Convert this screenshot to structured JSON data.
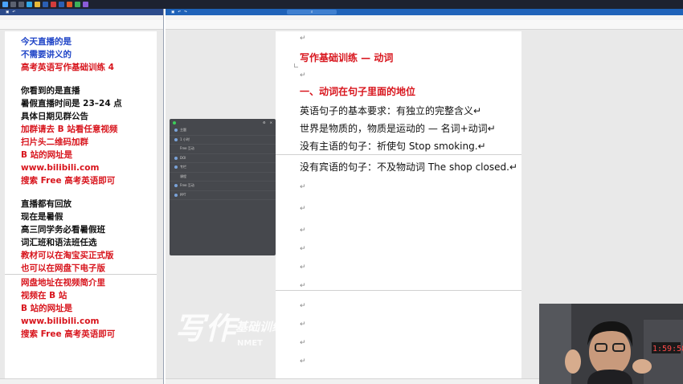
{
  "left_doc": {
    "lines": [
      {
        "text": "今天直播的是",
        "color": "blue"
      },
      {
        "text": "不需要讲义的",
        "color": "blue"
      },
      {
        "text": "高考英语写作基础训练 4",
        "color": "red"
      },
      {
        "text": "你看到的是直播",
        "color": "black"
      },
      {
        "text": "暑假直播时间是 23–24 点",
        "color": "black"
      },
      {
        "text": "具体日期见群公告",
        "color": "black"
      },
      {
        "text": "加群请去 B 站看任意视频",
        "color": "red"
      },
      {
        "text": "扫片头二维码加群",
        "color": "red"
      },
      {
        "text": "B 站的网址是",
        "color": "red"
      },
      {
        "text": "www.bilibili.com",
        "color": "red"
      },
      {
        "text": "搜索 Free 高考英语即可",
        "color": "red"
      },
      {
        "text": "直播都有回放",
        "color": "black"
      },
      {
        "text": "现在是暑假",
        "color": "black"
      },
      {
        "text": "高三同学务必看暑假班",
        "color": "black"
      },
      {
        "text": "词汇班和语法班任选",
        "color": "black"
      },
      {
        "text": "教材可以在淘宝买正式版",
        "color": "red"
      },
      {
        "text": "也可以在网盘下电子版",
        "color": "red"
      },
      {
        "text": "网盘地址在视频简介里",
        "color": "red"
      },
      {
        "text": "视频在 B 站",
        "color": "red"
      },
      {
        "text": "B 站的网址是",
        "color": "red"
      },
      {
        "text": "www.bilibili.com",
        "color": "red"
      },
      {
        "text": "搜索 Free 高考英语即可",
        "color": "red"
      }
    ]
  },
  "right_doc": {
    "title": "写作基础训练 — 动词",
    "section": "一、动词在句子里面的地位",
    "body": [
      "英语句子的基本要求：有独立的完整含义",
      "世界是物质的，物质是运动的 — 名词+动词",
      "没有主语的句子：祈使句 Stop smoking.",
      "没有宾语的句子：不及物动词 The shop closed."
    ],
    "para_mark": "↵"
  },
  "watermark": {
    "line1": "写作",
    "line2": "基础训练",
    "line3": "NMET"
  },
  "overlay": {
    "rows": [
      "主题",
      "1 小时",
      "Free 互动",
      "DOI",
      "专栏",
      "课程",
      "Free 互动",
      "PPT"
    ]
  },
  "colors": {
    "red": "#d8151d",
    "blue": "#1f44c7",
    "left_title": "#2b4a8a",
    "right_title": "#1e62b8"
  }
}
